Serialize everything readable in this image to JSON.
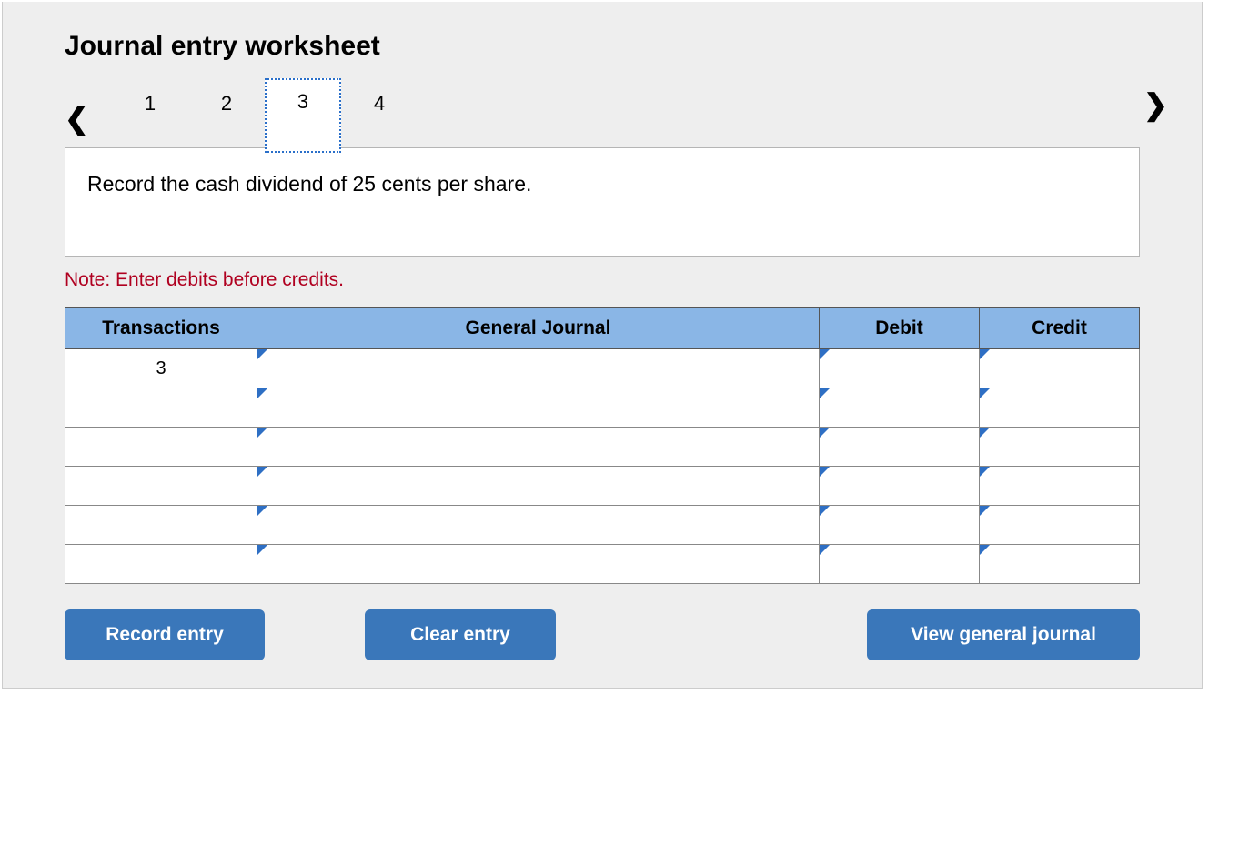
{
  "title": "Journal entry worksheet",
  "nav": {
    "steps": [
      "1",
      "2",
      "3",
      "4"
    ],
    "active_index": 2
  },
  "prompt": "Record the cash dividend of 25 cents per share.",
  "note": "Note: Enter debits before credits.",
  "table": {
    "headers": {
      "transactions": "Transactions",
      "general_journal": "General Journal",
      "debit": "Debit",
      "credit": "Credit"
    },
    "rows": [
      {
        "transaction": "3",
        "general_journal": "",
        "debit": "",
        "credit": ""
      },
      {
        "transaction": "",
        "general_journal": "",
        "debit": "",
        "credit": ""
      },
      {
        "transaction": "",
        "general_journal": "",
        "debit": "",
        "credit": ""
      },
      {
        "transaction": "",
        "general_journal": "",
        "debit": "",
        "credit": ""
      },
      {
        "transaction": "",
        "general_journal": "",
        "debit": "",
        "credit": ""
      },
      {
        "transaction": "",
        "general_journal": "",
        "debit": "",
        "credit": ""
      }
    ]
  },
  "buttons": {
    "record": "Record entry",
    "clear": "Clear entry",
    "view": "View general journal"
  }
}
